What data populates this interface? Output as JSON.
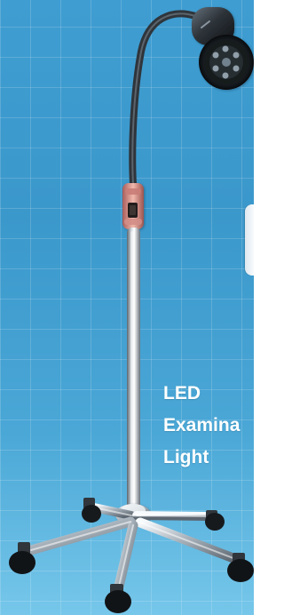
{
  "caption": {
    "line1": "LED",
    "line2": "Examina",
    "line3": "Light"
  }
}
